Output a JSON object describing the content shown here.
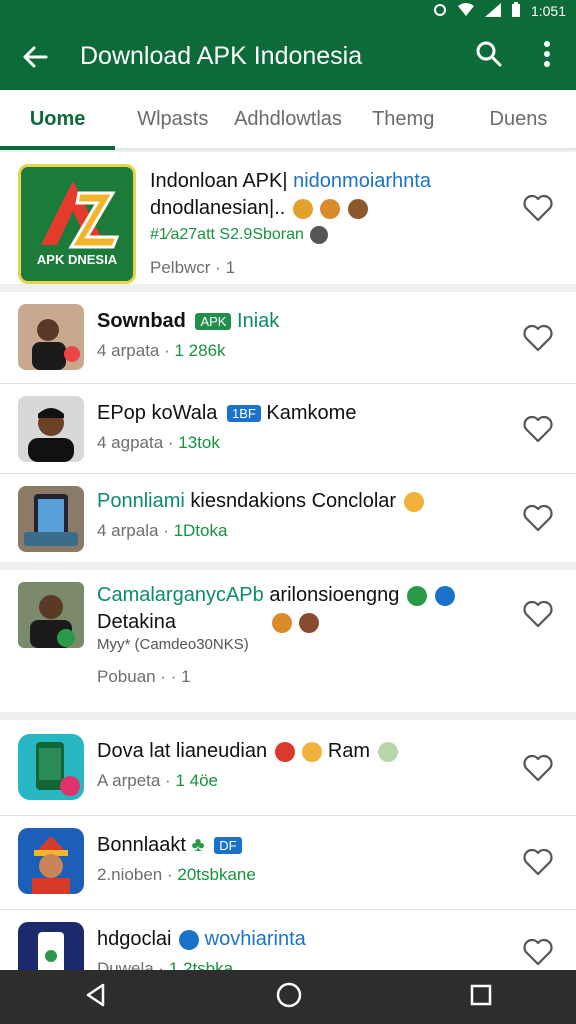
{
  "status": {
    "time": "1:051"
  },
  "appbar": {
    "title": "Download APK Indonesia"
  },
  "tabs": [
    "Uome",
    "Wlpasts",
    "Adhdlowtlas",
    "Themg",
    "Duens"
  ],
  "featured": {
    "logo_text": "APK DNESIA",
    "name_line1": "Indonloan APK|",
    "name_line1_link": "nidonmoiarhnta",
    "name_line2": "dnodlanesian|..",
    "meta": "#1⁄a27att S2.9Sboran",
    "rating": "Pelbwcr · 1"
  },
  "items": [
    {
      "name": "Sownbad",
      "badge": "APK",
      "tail": "Iniak",
      "meta_a": "4 arpata ·",
      "meta_b": "1 286k"
    },
    {
      "name": "EPop koWala",
      "badge": "1BF",
      "tail": "Kamkome",
      "meta_a": "4 agpata ·",
      "meta_b": "13tok"
    },
    {
      "name": "Ponnliami",
      "tail": "kiesndakions Conclolar",
      "meta_a": "4 arpala ·",
      "meta_b": "1Dtoka"
    }
  ],
  "featured2": {
    "name_link": "CamalarganycAPb",
    "name_rest": "arilonsioengng",
    "line2": "Detakina",
    "meta": "Myy* (Camdeo30NKS)",
    "rating": "Pobuan · · 1"
  },
  "items2": [
    {
      "name": "Dova lat lianeudian",
      "tail": "Ram",
      "meta_a": "A arpeta ·",
      "meta_b": "1 4öe"
    },
    {
      "name": "Bonnlaakt",
      "badge": "DF",
      "meta_a": "2.nioben ·",
      "meta_b": "20tsbkane"
    },
    {
      "name": "hdgoclai",
      "tail": "wovhiarinta",
      "meta_a": "Duwela ·",
      "meta_b": "1 2tsbka"
    }
  ],
  "colors": {
    "primary": "#0d6b3a",
    "link": "#1a73c8",
    "green_text": "#15933f"
  },
  "icons": [
    "back-arrow-icon",
    "search-icon",
    "more-vert-icon",
    "heart-outline-icon",
    "nav-back-icon",
    "nav-home-icon",
    "nav-recents-icon"
  ]
}
